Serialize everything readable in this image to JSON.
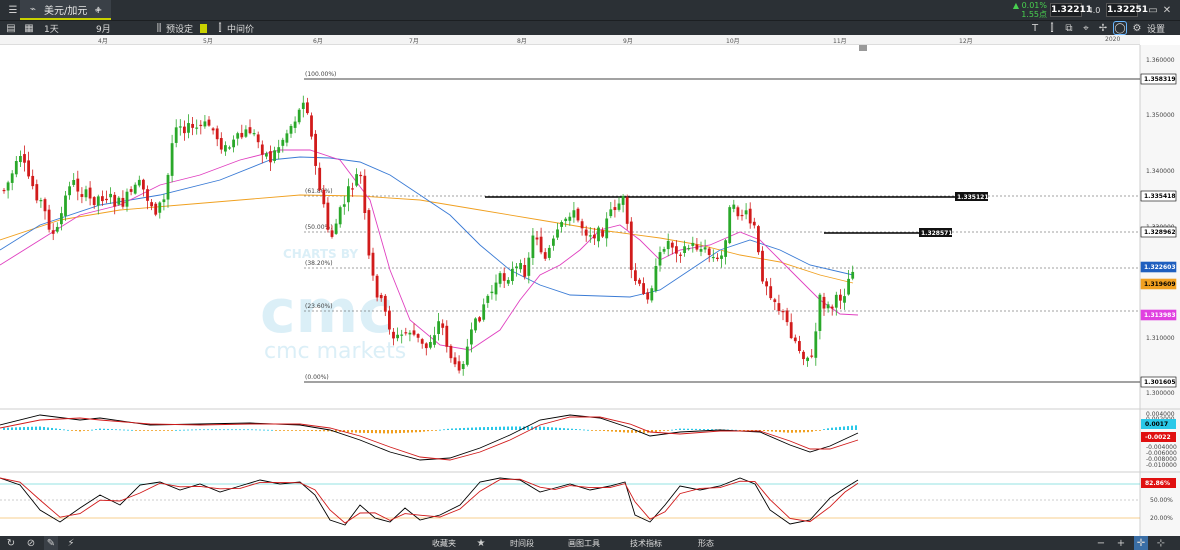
{
  "window": {
    "tab_label": "美元/加元",
    "new_tab": "+"
  },
  "toolbar": {
    "interval": "1天",
    "period": "9月",
    "preset_label": "预设定",
    "price_type": "中间价",
    "settings_label": "设置"
  },
  "quote": {
    "change_pct": "▲ 0.01%",
    "change_pts": "1.55点",
    "bid": "1.32211",
    "spread": "4.0",
    "ask": "1.32251"
  },
  "time_axis": [
    "4月",
    "5月",
    "6月",
    "7月",
    "8月",
    "9月",
    "10月",
    "11月",
    "12月",
    "2020"
  ],
  "price_axis": [
    "1.360000",
    "1.350000",
    "1.340000",
    "1.330000",
    "1.320000",
    "1.310000",
    "1.300000"
  ],
  "price_tags": {
    "fib_high": "1.358319",
    "res1": "1.335418",
    "res2": "1.328962",
    "current": "1.322603",
    "ma_orange": "1.319609",
    "ma_magenta": "1.313983",
    "fib_low": "1.301605"
  },
  "inline_tags": {
    "res1": "1.335121",
    "res2": "1.328571"
  },
  "fib_levels": [
    "(100.00%)",
    "(61.80%)",
    "(50.00%)",
    "(38.20%)",
    "(23.60%)",
    "(0.00%)"
  ],
  "watermark": {
    "charts_by": "CHARTS BY",
    "cmc_big": "cmc",
    "cmc_markets": "cmc markets"
  },
  "macd_axis": [
    "0.004000",
    "0.002000",
    "-0.004000",
    "-0.006000",
    "-0.008000",
    "-0.010000"
  ],
  "macd_tags": {
    "a": "0.0017",
    "b": "-0.0022"
  },
  "stoch_axis": [
    "50.00%",
    "20.00%"
  ],
  "stoch_tag": "82.86%",
  "bottom": {
    "watchlist": "收藏夹",
    "timeframe": "时间段",
    "drawing": "画图工具",
    "indicators": "技术指标",
    "patterns": "形态"
  },
  "colors": {
    "up": "#2aa82a",
    "down": "#d11b1b",
    "ma_blue": "#3a7bd5",
    "ma_orange": "#f0a020",
    "ma_magenta": "#e040c0",
    "accent": "#c9d100"
  },
  "icons": [
    "menu-icon",
    "chart-icon",
    "search-icon",
    "plus-icon",
    "layout-icon",
    "list-icon",
    "pause-icon",
    "bar-chart-icon",
    "cursor-icon",
    "settings-icon",
    "close-icon",
    "crosshair-icon",
    "pencil-icon",
    "star-icon",
    "zoom-in-icon",
    "zoom-out-icon"
  ]
}
